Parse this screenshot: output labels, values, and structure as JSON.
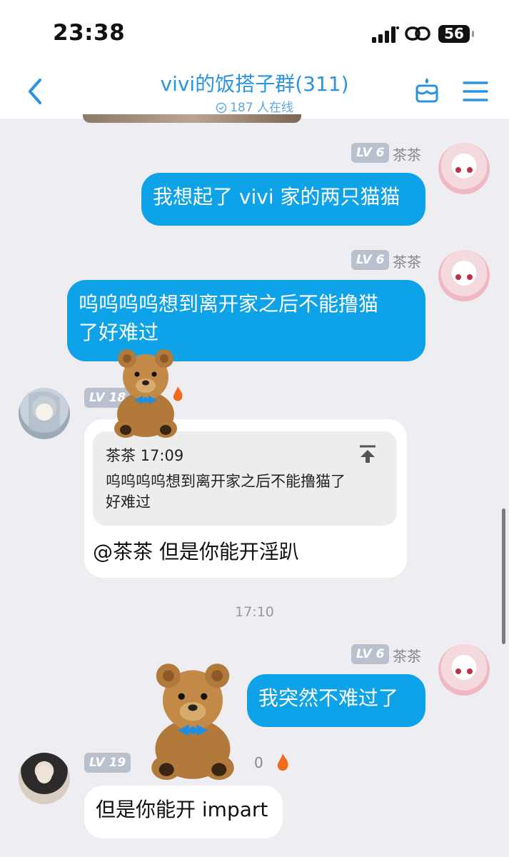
{
  "status_bar": {
    "time": "23:38",
    "battery": "56"
  },
  "header": {
    "back_icon": "chevron-left-icon",
    "title": "vivi的饭搭子群(311)",
    "online": "187 人在线",
    "accent": "#2a94e0"
  },
  "messages": [
    {
      "level": "LV 6",
      "sender": "茶茶",
      "text": "我想起了 vivi 家的两只猫猫"
    },
    {
      "level": "LV 6",
      "sender": "茶茶",
      "text_line1": "呜呜呜呜想到离开家之后不能撸猫",
      "text_line2": "了好难过"
    },
    {
      "level": "LV 18",
      "quote": {
        "sender_time": "茶茶 17:09",
        "line1": "呜呜呜呜想到离开家之后不能撸猫了",
        "line2": "好难过"
      },
      "text": "@茶茶 但是你能开淫趴"
    },
    {
      "level": "LV 6",
      "sender": "茶茶",
      "text": "我突然不难过了"
    },
    {
      "level": "LV 19",
      "partial_label": "0",
      "text": "但是你能开 impart"
    }
  ],
  "timestamp": "17:10",
  "colors": {
    "outgoing_bubble": "#0ea2e9",
    "incoming_bubble": "#ffffff",
    "background": "#ededf2"
  }
}
